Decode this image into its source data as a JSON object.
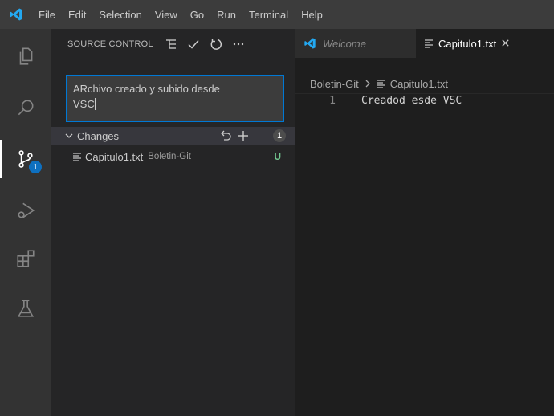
{
  "menu": [
    "File",
    "Edit",
    "Selection",
    "View",
    "Go",
    "Run",
    "Terminal",
    "Help"
  ],
  "activity": {
    "source_control_badge": "1",
    "icons": [
      "explorer-icon",
      "search-icon",
      "source-control-icon",
      "run-debug-icon",
      "extensions-icon",
      "testing-icon"
    ]
  },
  "sidebar": {
    "title": "SOURCE CONTROL",
    "commit_message_line1": "ARchivo creado y subido desde",
    "commit_message_line2": "VSC",
    "changes": {
      "label": "Changes",
      "count": "1",
      "files": [
        {
          "name": "Capitulo1.txt",
          "dir": "Boletin-Git",
          "status": "U"
        }
      ]
    }
  },
  "editor": {
    "tabs": [
      {
        "label": "Welcome",
        "active": false
      },
      {
        "label": "Capitulo1.txt",
        "active": true
      }
    ],
    "breadcrumb": {
      "folder": "Boletin-Git",
      "file": "Capitulo1.txt"
    },
    "lines": [
      {
        "number": "1",
        "text": "Creadod esde VSC"
      }
    ]
  },
  "colors": {
    "accent": "#0078d4",
    "badge": "#0e70c0",
    "untracked": "#73c991",
    "vscode_blue": "#23a9f2"
  }
}
